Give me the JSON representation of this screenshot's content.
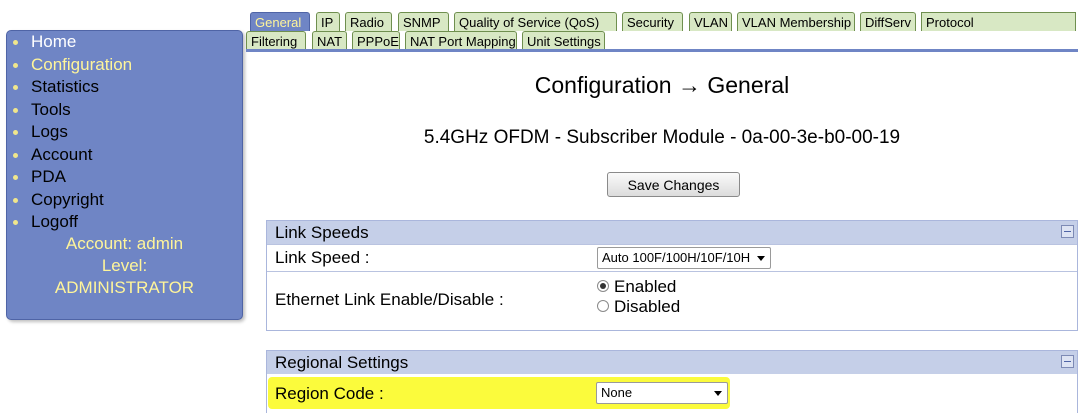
{
  "sidebar": {
    "items": [
      {
        "label": "Home",
        "color": "#ffffff"
      },
      {
        "label": "Configuration",
        "color": "#fff59a"
      },
      {
        "label": "Statistics",
        "color": "#000000"
      },
      {
        "label": "Tools",
        "color": "#000000"
      },
      {
        "label": "Logs",
        "color": "#000000"
      },
      {
        "label": "Account",
        "color": "#000000"
      },
      {
        "label": "PDA",
        "color": "#000000"
      },
      {
        "label": "Copyright",
        "color": "#000000"
      },
      {
        "label": "Logoff",
        "color": "#000000"
      }
    ],
    "account_line": "Account: admin",
    "level_line": "Level:",
    "level_value": "ADMINISTRATOR"
  },
  "tabs": [
    {
      "label": "General",
      "active": true
    },
    {
      "label": "IP"
    },
    {
      "label": "Radio"
    },
    {
      "label": "SNMP"
    },
    {
      "label": "Quality of Service (QoS)"
    },
    {
      "label": "Security"
    },
    {
      "label": "VLAN"
    },
    {
      "label": "VLAN Membership"
    },
    {
      "label": "DiffServ"
    },
    {
      "label": "Protocol"
    },
    {
      "label": "Filtering"
    },
    {
      "label": "NAT"
    },
    {
      "label": "PPPoE"
    },
    {
      "label": "NAT Port Mapping"
    },
    {
      "label": "Unit Settings"
    }
  ],
  "main": {
    "title": "Configuration → General",
    "subtitle": "5.4GHz OFDM - Subscriber Module - 0a-00-3e-b0-00-19",
    "save_label": "Save Changes"
  },
  "link_speeds": {
    "header": "Link Speeds",
    "link_speed_label": "Link Speed :",
    "link_speed_value": "Auto 100F/100H/10F/10H",
    "ethernet_label": "Ethernet Link Enable/Disable :",
    "enabled_label": "Enabled",
    "disabled_label": "Disabled",
    "selected": "Enabled"
  },
  "regional": {
    "header": "Regional Settings",
    "region_label": "Region Code :",
    "region_value": "None"
  },
  "colors": {
    "accent": "#6f85c5",
    "highlight": "#fbfb3c",
    "tab_bg": "#d8e8c4"
  }
}
